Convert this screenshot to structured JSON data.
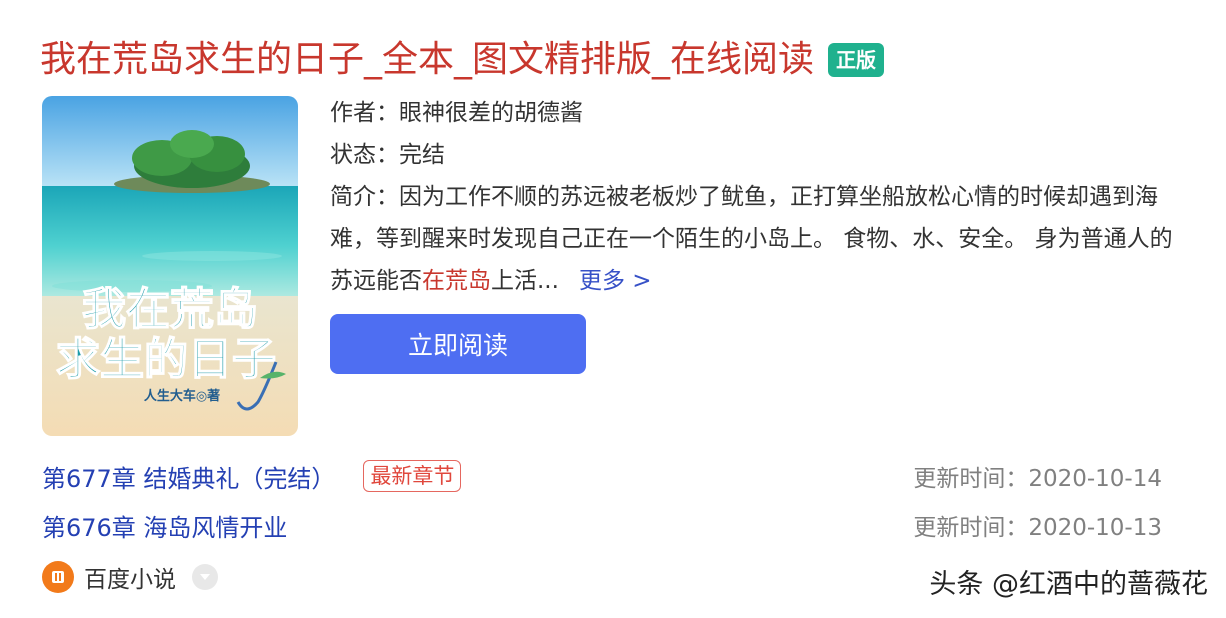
{
  "book": {
    "title": "我在荒岛求生的日子_全本_图文精排版_在线阅读",
    "official_badge": "正版",
    "author_line": "作者：眼神很差的胡德酱",
    "status_line": "状态：完结",
    "desc_before": "简介：因为工作不顺的苏远被老板炒了鱿鱼，正打算坐船放松心情的时候却遇到海难，等到醒来时发现自己正在一个陌生的小岛上。 食物、水、安全。 身为普通人的苏远能否",
    "desc_highlight": "在荒岛",
    "desc_after": "上活...",
    "more_link": "更多 >",
    "read_button": "立即阅读",
    "cover_title_line1": "我在荒岛",
    "cover_title_line2": "求生的日子",
    "cover_author": "人生大车◎著"
  },
  "chapters": [
    {
      "title": "第677章 结婚典礼（完结）",
      "tag": "最新章节",
      "update": "更新时间：2020-10-14"
    },
    {
      "title": "第676章 海岛风情开业",
      "tag": "",
      "update": "更新时间：2020-10-13"
    }
  ],
  "source": {
    "name": "百度小说",
    "icon": "baidu-novel-icon"
  },
  "watermark": "头条 @红酒中的蔷薇花",
  "colors": {
    "title": "#c8372d",
    "badge": "#1fb18e",
    "button": "#4e6ef2",
    "link": "#2440b3"
  }
}
